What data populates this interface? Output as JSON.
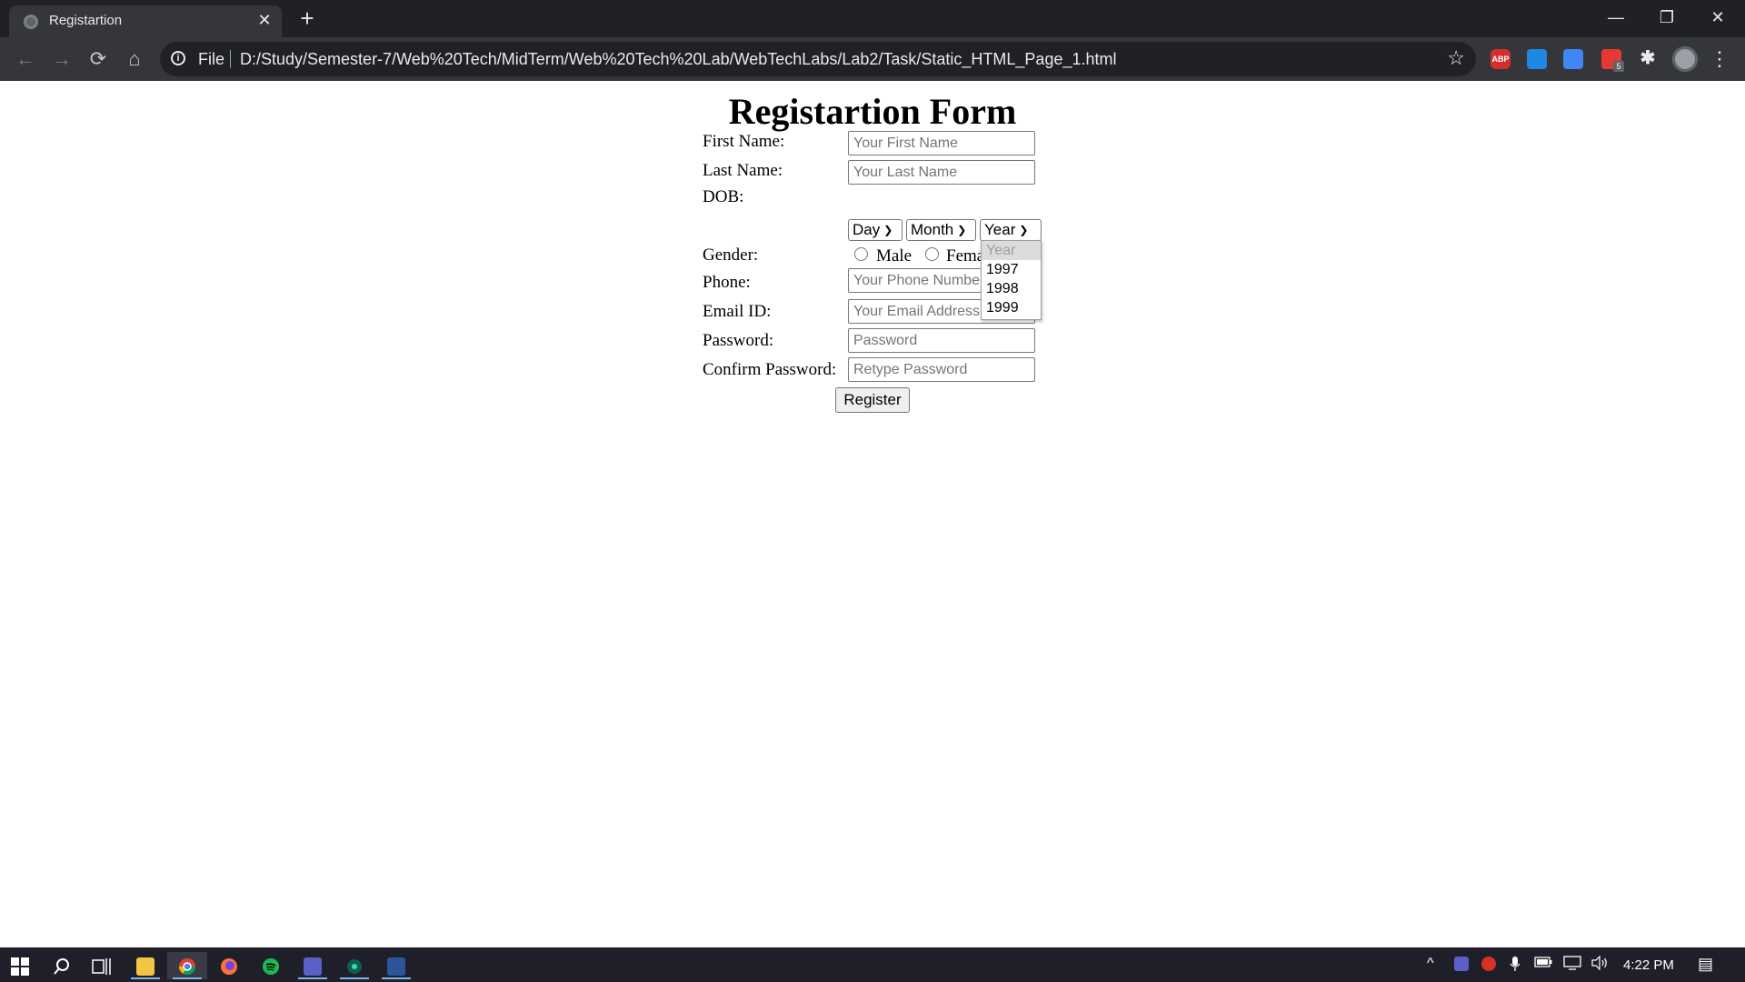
{
  "browser": {
    "tab_title": "Registartion",
    "tab_close": "✕",
    "new_tab": "+",
    "window_controls": {
      "minimize": "—",
      "maximize": "❐",
      "close": "✕"
    },
    "nav": {
      "back": "←",
      "forward": "→",
      "reload": "⟳",
      "home": "⌂"
    },
    "omnibox": {
      "info_icon": "i",
      "scheme": "File",
      "url": "D:/Study/Semester-7/Web%20Tech/MidTerm/Web%20Tech%20Lab/WebTechLabs/Lab2/Task/Static_HTML_Page_1.html",
      "star": "☆"
    },
    "extensions": {
      "abp": "ABP",
      "calendar_badge": "5",
      "puzzle": "✱",
      "menu": "⋮"
    }
  },
  "page": {
    "title": "Registartion Form",
    "labels": {
      "first_name": "First Name:",
      "last_name": "Last Name:",
      "dob": "DOB:",
      "gender": "Gender:",
      "phone": "Phone:",
      "email": "Email ID:",
      "password": "Password:",
      "confirm_password": "Confirm Password:"
    },
    "placeholders": {
      "first_name": "Your First Name",
      "last_name": "Your Last Name",
      "phone": "Your Phone Number",
      "email": "Your Email Address",
      "password": "Password",
      "confirm_password": "Retype Password"
    },
    "dob": {
      "day": "Day",
      "month": "Month",
      "year": "Year",
      "year_options": [
        "Year",
        "1997",
        "1998",
        "1999"
      ]
    },
    "gender": {
      "male": "Male",
      "female": "Female"
    },
    "register": "Register"
  },
  "taskbar": {
    "clock": "4:22 PM",
    "tray_chevron": "^",
    "notifications": "▤"
  },
  "colors": {
    "chrome_dark": "#202124",
    "toolbar": "#35363a",
    "taskbar": "#1f1f2a",
    "abp_red": "#d32f2f"
  },
  "icons": [
    "tab-favicon-icon",
    "close-icon",
    "plus-icon",
    "back-icon",
    "forward-icon",
    "reload-icon",
    "home-icon",
    "info-icon",
    "star-icon",
    "puzzle-icon",
    "menu-icon",
    "windows-start-icon",
    "search-icon",
    "task-view-icon",
    "file-explorer-icon",
    "chrome-icon",
    "firefox-icon",
    "spotify-icon",
    "teams-icon",
    "word-icon",
    "notification-icon"
  ]
}
